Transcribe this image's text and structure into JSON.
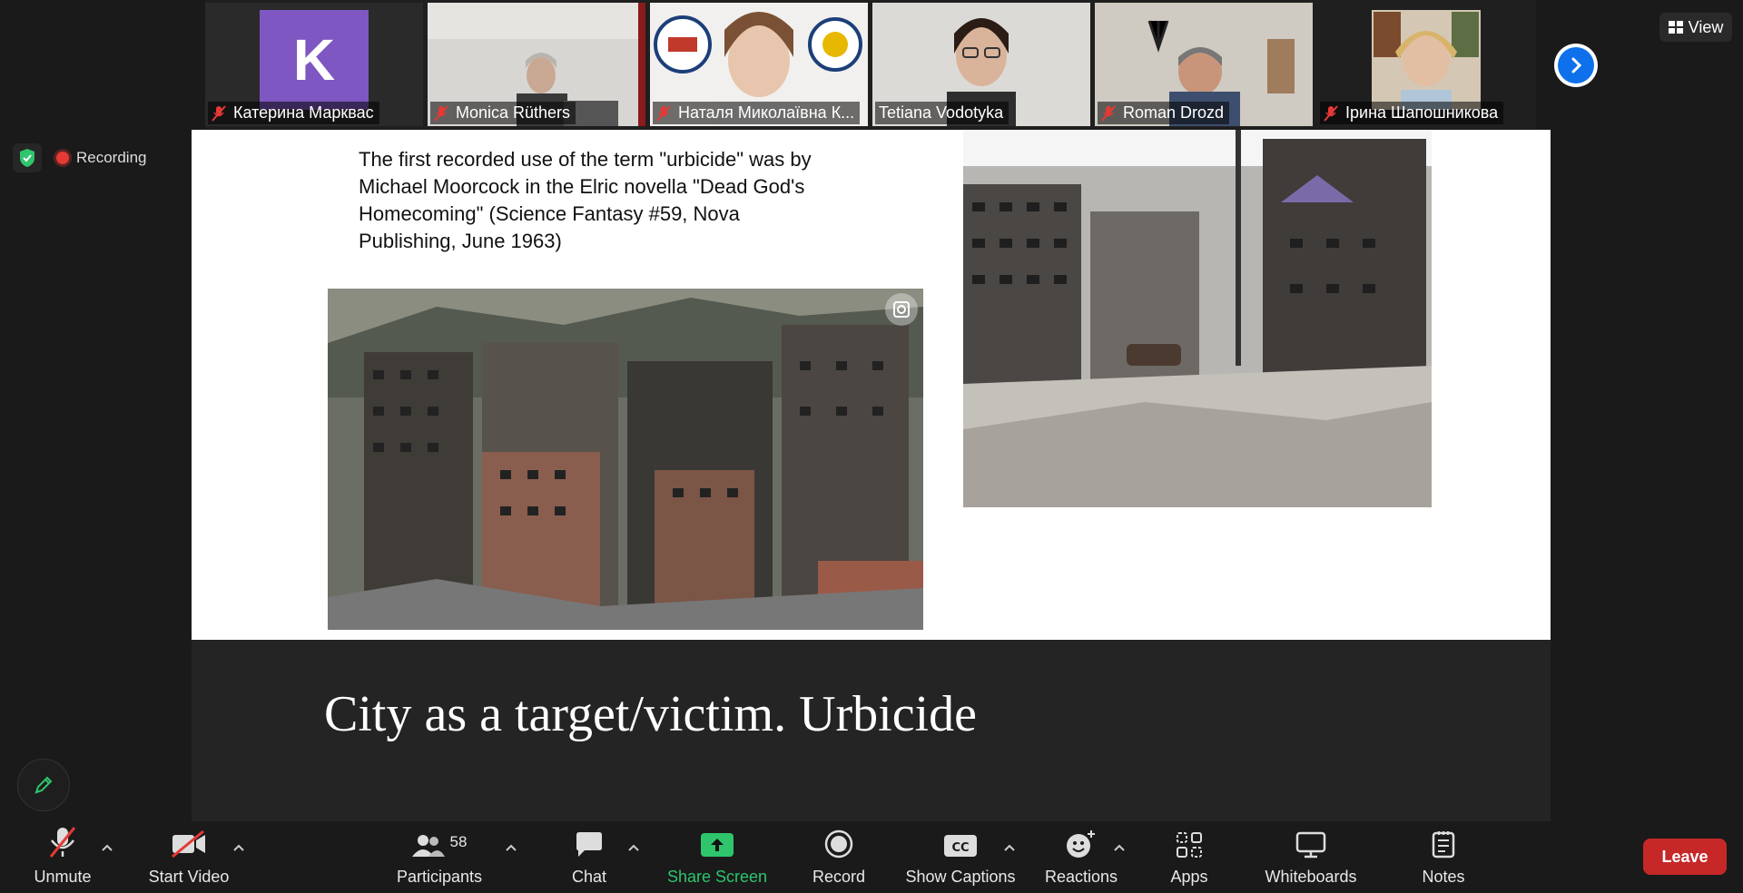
{
  "participants": [
    {
      "name": "Катерина Марквас",
      "initial": "K",
      "muted": true
    },
    {
      "name": "Monica Rüthers",
      "muted": true
    },
    {
      "name": "Наталя Миколаївна К...",
      "muted": true
    },
    {
      "name": "Tetiana Vodotyka",
      "muted": false,
      "active": true
    },
    {
      "name": "Roman Drozd",
      "muted": true
    },
    {
      "name": "Ірина Шапошникова",
      "muted": true
    }
  ],
  "view_label": "View",
  "recording_label": "Recording",
  "slide": {
    "text": "The first recorded use of the term \"urbicide\" was by Michael Moorcock in the Elric novella \"Dead God's Homecoming\" (Science Fantasy #59, Nova Publishing, June 1963)",
    "title": "City as a target/victim. Urbicide"
  },
  "toolbar": {
    "unmute": "Unmute",
    "start_video": "Start Video",
    "participants": "Participants",
    "participants_count": "58",
    "chat": "Chat",
    "share_screen": "Share Screen",
    "record": "Record",
    "show_captions": "Show Captions",
    "reactions": "Reactions",
    "apps": "Apps",
    "whiteboards": "Whiteboards",
    "notes": "Notes",
    "leave": "Leave"
  },
  "colors": {
    "accent_blue": "#0e71eb",
    "share_green": "#2ec56d",
    "leave_red": "#c62828",
    "active_speaker": "#8bc34a"
  },
  "icons": {
    "mic": "mic-muted-icon",
    "video": "video-off-icon",
    "participants": "people-icon",
    "chat": "chat-bubble-icon",
    "share": "share-arrow-up-icon",
    "record": "record-circle-icon",
    "captions": "cc-icon",
    "reactions": "smiley-plus-icon",
    "apps": "apps-icon",
    "whiteboards": "whiteboard-icon",
    "notes": "notes-icon"
  }
}
